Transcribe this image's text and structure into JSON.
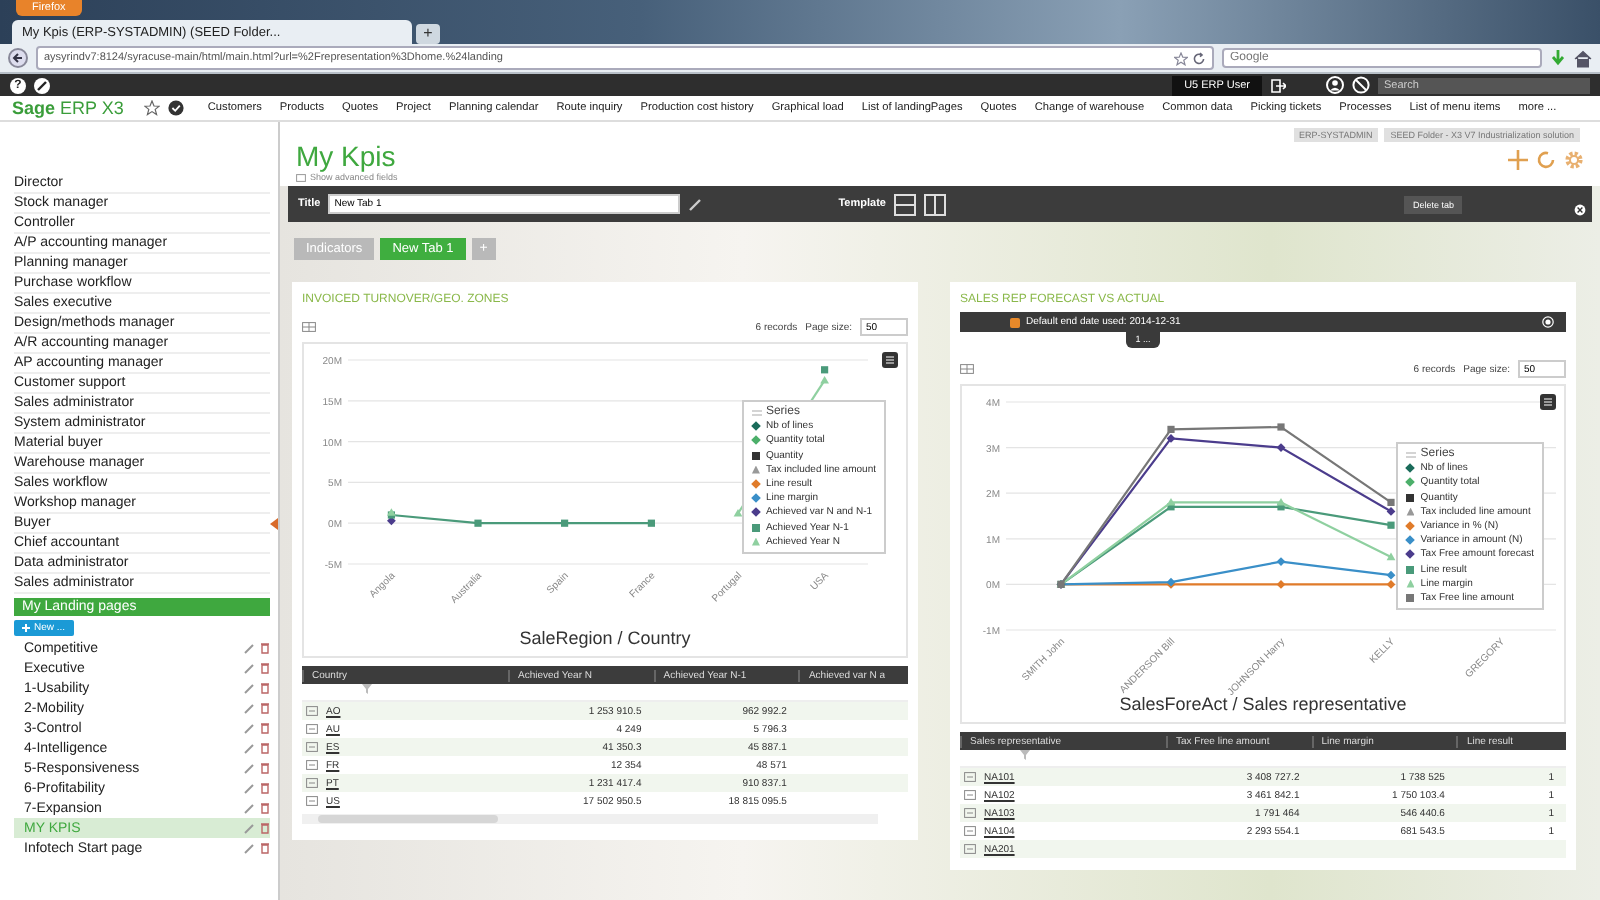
{
  "browser": {
    "menu_button": "Firefox",
    "tab_title": "My Kpis (ERP-SYSTADMIN) (SEED Folder...",
    "new_tab": "+",
    "url": "aysyrindv7:8124/syracuse-main/html/main.html?url=%2Frepresentation%3Dhome.%24landing",
    "search_placeholder": "Google"
  },
  "top_bar": {
    "help": "?",
    "user": "U5 ERP User",
    "search_placeholder": "Search"
  },
  "nav": {
    "logo_bold": "Sage",
    "logo_rest": "ERP X3",
    "items": [
      "Customers",
      "Products",
      "Quotes",
      "Project",
      "Planning calendar",
      "Route inquiry",
      "Production cost history",
      "Graphical load",
      "List of landingPages",
      "Quotes",
      "Change of warehouse",
      "Common data",
      "Picking tickets",
      "Processes",
      "List of menu items",
      "more ..."
    ]
  },
  "sidebar": {
    "roles": [
      "Director",
      "Stock manager",
      "Controller",
      "A/P accounting manager",
      "Planning manager",
      "Purchase workflow",
      "Sales executive",
      "Design/methods manager",
      "A/R accounting manager",
      "AP accounting manager",
      "Customer support",
      "Sales administrator",
      "System administrator",
      "Material buyer",
      "Warehouse manager",
      "Sales workflow",
      "Workshop manager",
      "Buyer",
      "Chief accountant",
      "Data administrator",
      "Sales administrator"
    ],
    "landing_header": "My Landing pages",
    "new_button": "New ...",
    "landing_pages": [
      {
        "label": "Competitive",
        "selected": false
      },
      {
        "label": "Executive",
        "selected": false
      },
      {
        "label": "1-Usability",
        "selected": false
      },
      {
        "label": "2-Mobility",
        "selected": false
      },
      {
        "label": "3-Control",
        "selected": false
      },
      {
        "label": "4-Intelligence",
        "selected": false
      },
      {
        "label": "5-Responsiveness",
        "selected": false
      },
      {
        "label": "6-Profitability",
        "selected": false
      },
      {
        "label": "7-Expansion",
        "selected": false
      },
      {
        "label": "MY KPIS",
        "selected": true
      },
      {
        "label": "Infotech Start page",
        "selected": false
      }
    ]
  },
  "breadcrumbs": [
    "ERP-SYSTADMIN",
    "SEED Folder - X3 V7 Industrialization solution"
  ],
  "page": {
    "title": "My Kpis",
    "advanced_link": "Show advanced fields"
  },
  "tab_editor": {
    "title_label": "Title",
    "title_value": "New Tab 1",
    "template_label": "Template",
    "delete_button": "Delete tab"
  },
  "tabs": [
    {
      "label": "Indicators",
      "selected": false
    },
    {
      "label": "New Tab 1",
      "selected": true
    }
  ],
  "add_tab": "+",
  "panels": [
    {
      "title": "INVOICED TURNOVER/GEO. ZONES",
      "records": "6 records",
      "page_size_label": "Page size:",
      "page_size": "50",
      "legend_title": "Series",
      "chart_data": {
        "type": "line",
        "grid": true,
        "legend": "right",
        "xlabel": "SaleRegion / Country",
        "categories": [
          "Angola",
          "Australia",
          "Spain",
          "France",
          "Portugal",
          "USA"
        ],
        "ylim": [
          -5,
          20
        ],
        "yticks": [
          {
            "value": -5,
            "label": "-5M"
          },
          {
            "value": 0,
            "label": "0M"
          },
          {
            "value": 5,
            "label": "5M"
          },
          {
            "value": 10,
            "label": "10M"
          },
          {
            "value": 15,
            "label": "15M"
          },
          {
            "value": 20,
            "label": "20M"
          }
        ],
        "series": [
          {
            "name": "Nb of lines",
            "color": "#1a6b5a",
            "marker": "diamond",
            "values": [
              null,
              null,
              null,
              null,
              null,
              null
            ]
          },
          {
            "name": "Quantity total",
            "color": "#4caf6a",
            "marker": "diamond",
            "values": [
              null,
              null,
              null,
              null,
              null,
              null
            ]
          },
          {
            "name": "Quantity",
            "color": "#333333",
            "marker": "square",
            "values": [
              null,
              null,
              null,
              null,
              null,
              null
            ]
          },
          {
            "name": "Tax included line amount",
            "color": "#999999",
            "marker": "triangle",
            "values": [
              null,
              null,
              null,
              null,
              null,
              null
            ]
          },
          {
            "name": "Line result",
            "color": "#e07b2a",
            "marker": "diamond",
            "values": [
              null,
              null,
              null,
              null,
              null,
              null
            ]
          },
          {
            "name": "Line margin",
            "color": "#3a8fc8",
            "marker": "diamond",
            "values": [
              null,
              null,
              null,
              null,
              null,
              null
            ]
          },
          {
            "name": "Achieved var N and N-1",
            "color": "#4b3c8c",
            "marker": "diamond",
            "values": [
              0.3,
              null,
              null,
              null,
              null,
              null
            ]
          },
          {
            "name": "Achieved Year N-1",
            "color": "#4a9a7a",
            "marker": "square",
            "values": [
              1,
              0,
              0,
              0,
              null,
              18.8
            ]
          },
          {
            "name": "Achieved Year N",
            "color": "#8fd0a0",
            "marker": "triangle",
            "values": [
              1.3,
              null,
              null,
              null,
              1.2,
              17.5
            ]
          }
        ]
      },
      "table": {
        "columns": [
          "Country",
          "Achieved Year N",
          "Achieved Year N-1",
          "Achieved var N a"
        ],
        "rows": [
          [
            "AO",
            "1 253 910.5",
            "962 992.2"
          ],
          [
            "AU",
            "4 249",
            "5 796.3"
          ],
          [
            "ES",
            "41 350.3",
            "45 887.1"
          ],
          [
            "FR",
            "12 354",
            "48 571"
          ],
          [
            "PT",
            "1 231 417.4",
            "910 837.1"
          ],
          [
            "US",
            "17 502 950.5",
            "18 815 095.5"
          ]
        ]
      }
    },
    {
      "title": "SALES REP FORECAST VS ACTUAL",
      "message": "Default end date used: 2014-12-31",
      "message_tab": "1 ...",
      "records": "6 records",
      "page_size_label": "Page size:",
      "page_size": "50",
      "legend_title": "Series",
      "chart_data": {
        "type": "line",
        "grid": true,
        "legend": "right",
        "xlabel": "SalesForeAct / Sales representative",
        "categories": [
          "SMITH John",
          "ANDERSON Bill",
          "JOHNSON Harry",
          "KELLY",
          "GREGORY"
        ],
        "ylim": [
          -1,
          4
        ],
        "yticks": [
          {
            "value": -1,
            "label": "-1M"
          },
          {
            "value": 0,
            "label": "0M"
          },
          {
            "value": 1,
            "label": "1M"
          },
          {
            "value": 2,
            "label": "2M"
          },
          {
            "value": 3,
            "label": "3M"
          },
          {
            "value": 4,
            "label": "4M"
          }
        ],
        "series": [
          {
            "name": "Nb of lines",
            "color": "#1a6b5a",
            "marker": "diamond",
            "values": [
              null,
              null,
              null,
              null,
              null
            ]
          },
          {
            "name": "Quantity total",
            "color": "#4caf6a",
            "marker": "diamond",
            "values": [
              null,
              null,
              null,
              null,
              null
            ]
          },
          {
            "name": "Quantity",
            "color": "#333333",
            "marker": "square",
            "values": [
              null,
              null,
              null,
              null,
              null
            ]
          },
          {
            "name": "Tax included line amount",
            "color": "#999999",
            "marker": "triangle",
            "values": [
              null,
              null,
              null,
              null,
              null
            ]
          },
          {
            "name": "Variance in % (N)",
            "color": "#e07b2a",
            "marker": "diamond",
            "values": [
              0,
              0,
              0,
              0,
              null
            ]
          },
          {
            "name": "Variance in amount (N)",
            "color": "#3a8fc8",
            "marker": "diamond",
            "values": [
              0,
              0.05,
              0.5,
              0.2,
              null
            ]
          },
          {
            "name": "Tax Free amount forecast",
            "color": "#4b3c8c",
            "marker": "diamond",
            "values": [
              0,
              3.2,
              3.0,
              1.6,
              null
            ]
          },
          {
            "name": "Line result",
            "color": "#4a9a7a",
            "marker": "square",
            "values": [
              0,
              1.7,
              1.7,
              1.3,
              null
            ]
          },
          {
            "name": "Line margin",
            "color": "#8fd0a0",
            "marker": "triangle",
            "values": [
              0,
              1.8,
              1.8,
              0.6,
              null
            ]
          },
          {
            "name": "Tax Free line amount",
            "color": "#777777",
            "marker": "square",
            "values": [
              0,
              3.4,
              3.45,
              1.8,
              null
            ]
          }
        ]
      },
      "table": {
        "columns": [
          "Sales representative",
          "Tax Free line amount",
          "Line margin",
          "Line result"
        ],
        "rows": [
          [
            "NA101",
            "3 408 727.2",
            "1 738 525",
            "1"
          ],
          [
            "NA102",
            "3 461 842.1",
            "1 750 103.4",
            "1"
          ],
          [
            "NA103",
            "1 791 464",
            "546 440.6",
            "1"
          ],
          [
            "NA104",
            "2 293 554.1",
            "681 543.5",
            "1"
          ],
          [
            "NA201"
          ]
        ]
      }
    }
  ]
}
